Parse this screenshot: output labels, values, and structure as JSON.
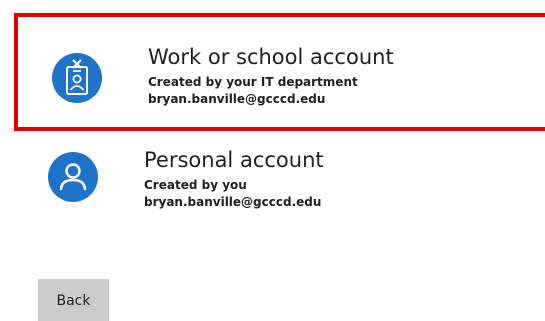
{
  "accounts": {
    "work": {
      "title": "Work or school account",
      "created_by": "Created by your IT department",
      "email": "bryan.banville@gcccd.edu",
      "icon": "id-badge-icon"
    },
    "personal": {
      "title": "Personal account",
      "created_by": "Created by you",
      "email": "bryan.banville@gcccd.edu",
      "icon": "person-icon"
    }
  },
  "buttons": {
    "back_label": "Back"
  },
  "colors": {
    "accent": "#1f73c9",
    "highlight_border": "#e00000",
    "button_bg": "#cccccc"
  }
}
